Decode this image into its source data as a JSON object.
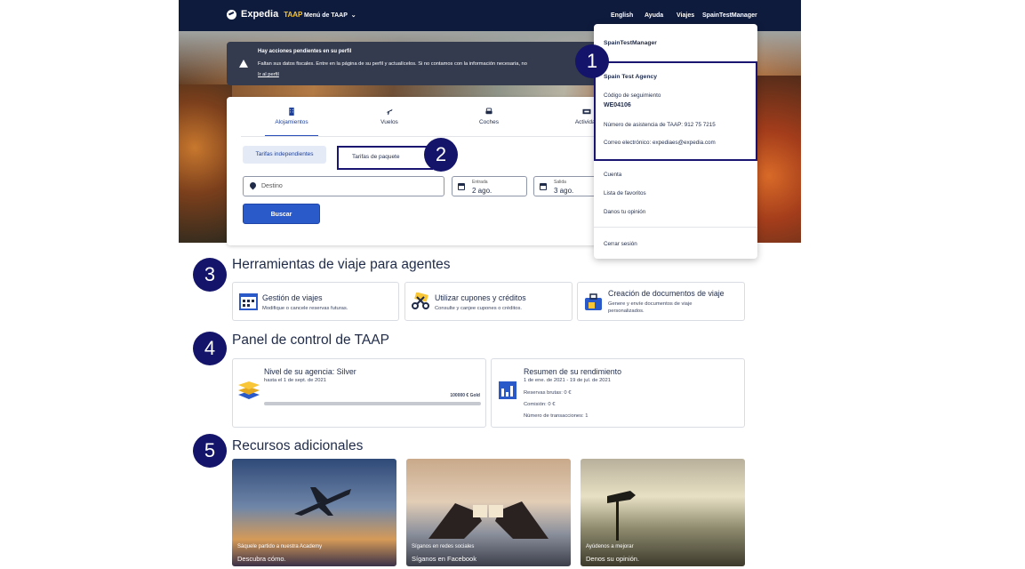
{
  "header": {
    "brand": "Expedia",
    "brand_suffix": "TAAP",
    "menu_label": "Menú de TAAP",
    "links": [
      "English",
      "Ayuda",
      "Viajes",
      "SpainTestManager"
    ]
  },
  "alert": {
    "title": "Hay acciones pendientes en su perfil",
    "message": "Faltan sus datos fiscales. Entre en la página de su perfil y actualícelos. Si no contamos con la información necesaria, no",
    "link": "Ir al perfil"
  },
  "search": {
    "tabs": [
      "Alojamientos",
      "Vuelos",
      "Coches",
      "Actividad"
    ],
    "rate_options": [
      "Tarifas independientes",
      "Tarifas de paquete"
    ],
    "destination_placeholder": "Destino",
    "checkin_label": "Entrada",
    "checkin_value": "2 ago.",
    "checkout_label": "Salida",
    "checkout_value": "3 ago.",
    "submit_label": "Buscar"
  },
  "account_menu": {
    "username": "SpainTestManager",
    "agency": "Spain Test Agency",
    "tracking_label": "Código de seguimiento",
    "tracking_code": "WE04106",
    "support_phone": "Número de asistencia de TAAP: 912 75 7215",
    "email": "Correo electrónico: expediaes@expedia.com",
    "items": [
      "Cuenta",
      "Lista de favoritos",
      "Danos tu opinión"
    ],
    "signout": "Cerrar sesión"
  },
  "markers": [
    "1",
    "2",
    "3",
    "4",
    "5"
  ],
  "tools": {
    "title": "Herramientas de viaje para agentes",
    "cards": [
      {
        "title": "Gestión de viajes",
        "desc": "Modifique o cancele reservas futuras.",
        "icon": "calendar-icon"
      },
      {
        "title": "Utilizar cupones y créditos",
        "desc": "Consulte y canjee cupones o créditos.",
        "icon": "scissors-coupon-icon"
      },
      {
        "title": "Creación de documentos de viaje",
        "desc": "Genere y envíe documentos de viaje personalizados.",
        "icon": "suitcase-document-icon"
      }
    ]
  },
  "dashboard": {
    "title": "Panel de control de TAAP",
    "level_title": "Nivel de su agencia: Silver",
    "level_date": "hasta el 1 de sept. de 2021",
    "level_goal": "100000 € Gold",
    "level_progress": 0,
    "perf_title": "Resumen de su rendimiento",
    "perf_period": "1 de ene. de 2021 - 19 de jul. de 2021",
    "perf_rows": [
      "Reservas brutas: 0 €",
      "Comisión: 0 €",
      "Número de transacciones: 1"
    ]
  },
  "resources": {
    "title": "Recursos adicionales",
    "cards": [
      {
        "caption": "Sáquele partido a nuestra Academy",
        "action": "Descubra cómo."
      },
      {
        "caption": "Síganos en redes sociales",
        "action": "Síganos en Facebook"
      },
      {
        "caption": "Ayúdenos a mejorar",
        "action": "Denos su opinión."
      }
    ]
  }
}
